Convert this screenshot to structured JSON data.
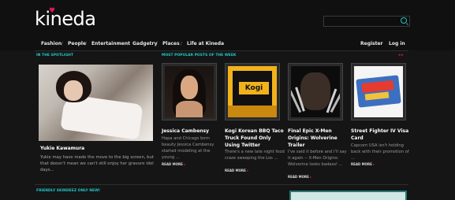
{
  "logo": {
    "text": "kineda",
    "heart": "♥"
  },
  "search": {
    "placeholder": ""
  },
  "nav": {
    "items": [
      "Fashion",
      "People",
      "Entertainment",
      "Gadgetry",
      "Places",
      "Life at Kineda"
    ],
    "sep": "/",
    "right": [
      "Register",
      "Log in"
    ]
  },
  "spotlight": {
    "label": "IN THE SPOTLIGHT",
    "title": "Yukie Kawamura",
    "desc": "Yukie may have made the move to the big screen, but that doesn't mean we can't still enjoy her gravure idol days..."
  },
  "popular": {
    "label": "MOST POPULAR POSTS OF THE WEEK",
    "arrows": "◂ ▸",
    "posts": [
      {
        "title": "Jessica Cambensy",
        "desc": "Hapa and Chicago born beauty Jessica Cambensy started modeling at the young ...",
        "readmore": "READ MORE",
        "thumb": "portrait"
      },
      {
        "title": "Kogi Korean BBQ Taco Truck Found Only Using Twitter",
        "desc": "There's a new late night food craze sweeping the Los ...",
        "readmore": "READ MORE",
        "thumb": "kogi"
      },
      {
        "title": "Final Epic X-Men Origins: Wolverine Trailer",
        "desc": "I've said it before and I'll say it again -- X-Men Origins: Wolverine looks badass! ...",
        "readmore": "READ MORE",
        "thumb": "wolverine"
      },
      {
        "title": "Street Fighter IV Visa Card",
        "desc": "Capcom USA isn't holding back with their promotion of ...",
        "readmore": "READ MORE",
        "thumb": "visa"
      }
    ]
  },
  "friendly": {
    "label": "FRIENDLY SKINDEEZ ONLY NEW!"
  },
  "colors": {
    "accent": "#20c6c9",
    "pink": "#e0155f",
    "bg": "#151515"
  }
}
